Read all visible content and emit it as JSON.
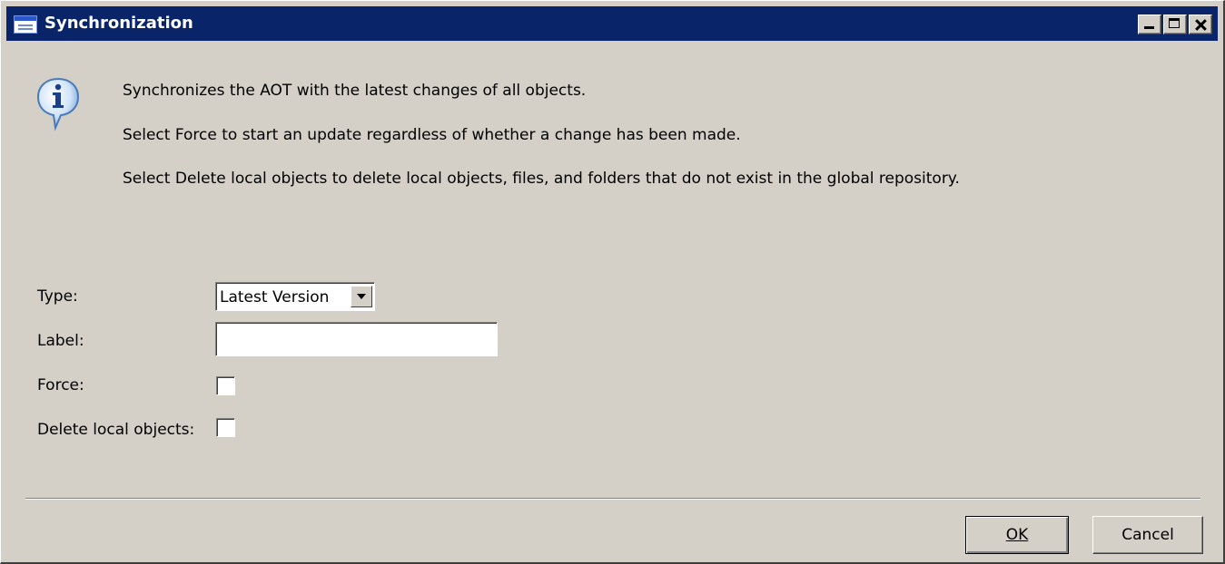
{
  "window": {
    "title": "Synchronization",
    "icon": "form-window-icon",
    "controls": [
      "minimize",
      "maximize",
      "close"
    ]
  },
  "info": {
    "icon": "info-icon",
    "lines": [
      "Synchronizes the AOT with the latest changes of all objects.",
      "Select Force to start an update regardless of whether a change has been made.",
      "Select Delete local objects to delete local objects, files, and folders that do not exist in the global repository."
    ]
  },
  "form": {
    "type": {
      "label": "Type:",
      "value": "Latest Version"
    },
    "label_field": {
      "label": "Label:",
      "value": ""
    },
    "force": {
      "label": "Force:",
      "checked": false
    },
    "delete_local": {
      "label": "Delete local objects:",
      "checked": false
    }
  },
  "buttons": {
    "ok_label": "OK",
    "cancel_label": "Cancel"
  }
}
